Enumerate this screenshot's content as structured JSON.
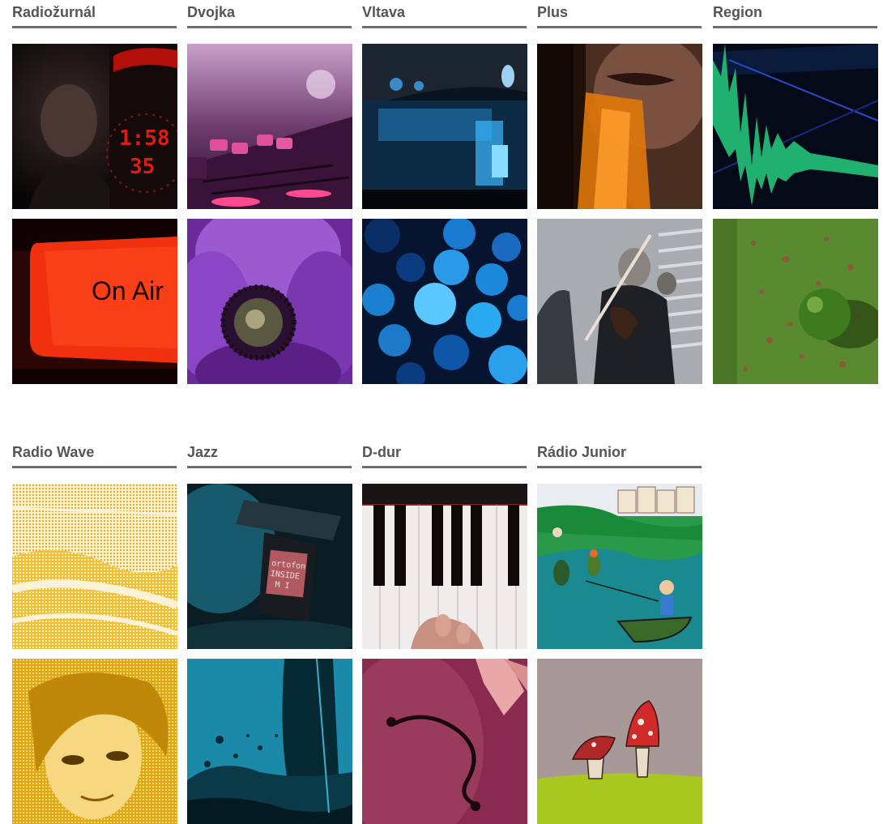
{
  "sections": [
    {
      "stations": [
        {
          "name": "Radiožurnál",
          "images": [
            "radiozurnal-studio-clock-image",
            "on-air-sign-image"
          ]
        },
        {
          "name": "Dvojka",
          "images": [
            "mixing-console-image",
            "purple-flower-image"
          ]
        },
        {
          "name": "Vltava",
          "images": [
            "turntable-blue-image",
            "blue-bokeh-image"
          ]
        },
        {
          "name": "Plus",
          "images": [
            "face-orange-light-image",
            "violinist-stairs-image"
          ]
        },
        {
          "name": "Region",
          "images": [
            "waveform-image",
            "green-ball-image"
          ]
        }
      ]
    },
    {
      "stations": [
        {
          "name": "Radio Wave",
          "images": [
            "yellow-pattern-image",
            "yellow-portrait-image"
          ]
        },
        {
          "name": "Jazz",
          "images": [
            "record-cartridge-image",
            "teal-ink-image"
          ]
        },
        {
          "name": "D-dur",
          "images": [
            "piano-keys-image",
            "violin-body-image"
          ]
        },
        {
          "name": "Rádio Junior",
          "images": [
            "illustration-fishing-image",
            "illustration-mushrooms-image"
          ]
        }
      ]
    }
  ],
  "on_air_text": "On Air",
  "cartridge_text": [
    "ortofon",
    "INSIDE",
    "M I"
  ]
}
